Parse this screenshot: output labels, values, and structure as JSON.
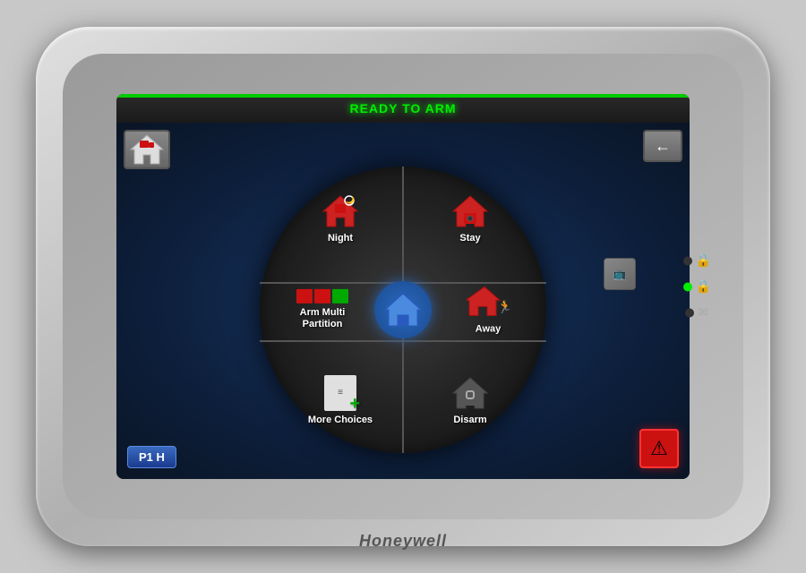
{
  "device": {
    "brand": "Honeywell"
  },
  "screen": {
    "status_bar": {
      "text": "READY TO ARM"
    },
    "bottom_left": {
      "label": "P1 H"
    }
  },
  "menu": {
    "segments": [
      {
        "id": "night",
        "label": "Night"
      },
      {
        "id": "stay",
        "label": "Stay"
      },
      {
        "id": "arm-multi",
        "label": "Arm Multi\nPartition"
      },
      {
        "id": "away",
        "label": "Away"
      },
      {
        "id": "more-choices",
        "label": "More Choices"
      },
      {
        "id": "disarm",
        "label": "Disarm"
      }
    ]
  },
  "icons": {
    "back_arrow": "←",
    "warning": "⚠",
    "lock": "🔒"
  }
}
